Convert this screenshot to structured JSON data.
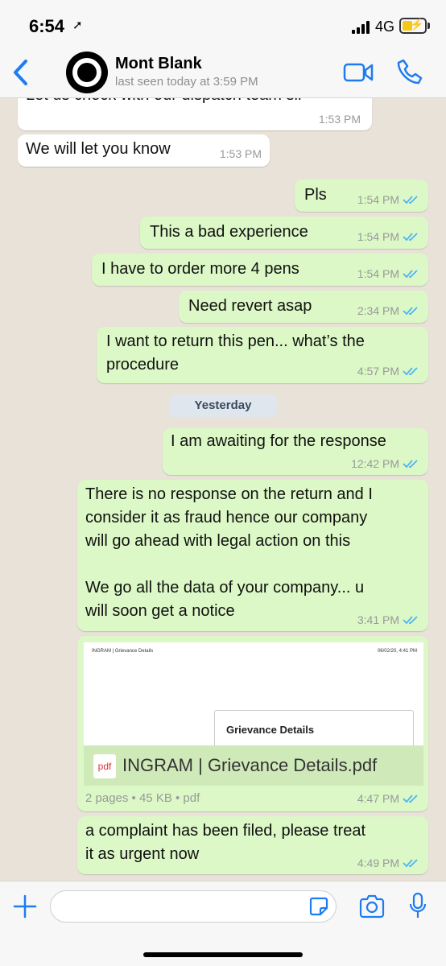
{
  "status_bar": {
    "time": "6:54",
    "network": "4G"
  },
  "header": {
    "name": "Mont Blank",
    "status": "last seen today at 3:59 PM"
  },
  "messages": [
    {
      "text": "Let us check with our dispatch team sir",
      "time": "1:53 PM"
    },
    {
      "text": "We will let you know",
      "time": "1:53 PM"
    },
    {
      "text": "Pls",
      "time": "1:54 PM"
    },
    {
      "text": "This a bad experience",
      "time": "1:54 PM"
    },
    {
      "text": "I have to order more 4 pens",
      "time": "1:54 PM"
    },
    {
      "text": "Need revert asap",
      "time": "2:34 PM"
    },
    {
      "text": "I want to return this pen... what’s the\nprocedure",
      "time": "4:57 PM"
    },
    {
      "text": "I am awaiting for the response",
      "time": "12:42 PM"
    },
    {
      "text": "There is no response on the return and I\nconsider it as fraud hence our company\nwill go ahead with legal action on this\n\nWe go all the data of your company... u\nwill soon get a notice",
      "time": "3:41 PM"
    },
    {
      "text": "a complaint has been filed, please treat\nit as urgent now",
      "time": "4:49 PM"
    }
  ],
  "day_separator": "Yesterday",
  "document": {
    "preview_left": "INGRAM | Grievance Details",
    "preview_right": "06/02/20, 4:41 PM",
    "preview_title": "Grievance Details",
    "icon_label": "pdf",
    "filename": "INGRAM | Grievance Details.pdf",
    "info": "2 pages • 45 KB • pdf",
    "time": "4:47 PM"
  },
  "colors": {
    "outgoing": "#dcf8c6",
    "incoming": "#ffffff",
    "accent": "#1e7cf2",
    "read_ticks": "#4fb3f6"
  }
}
